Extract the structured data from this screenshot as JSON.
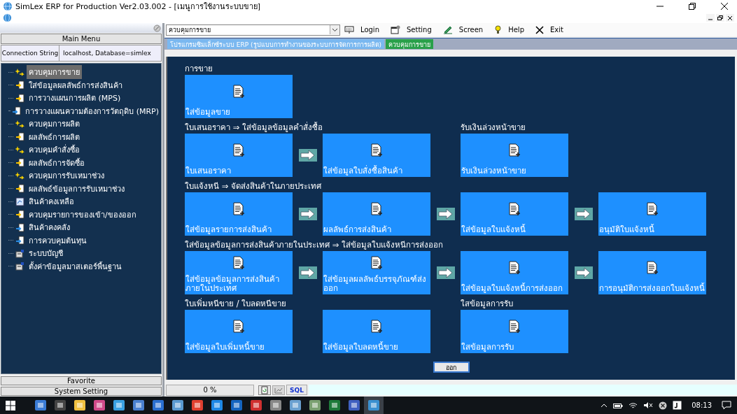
{
  "window": {
    "title": "SimLex ERP for Production Ver2.03.002 - [เมนูการใช้งานระบบขาย]"
  },
  "sidebar": {
    "header": "Main Menu",
    "connection": {
      "label": "Connection String",
      "value": "localhost,  Database=simlex"
    },
    "items": [
      {
        "label": "ควบคุมการขาย",
        "kind": "spark",
        "selected": true
      },
      {
        "label": "ใส่ข้อมูลผลลัพธ์การส่งสินค้า",
        "kind": "enter",
        "selected": false
      },
      {
        "label": "การวางแผนการผลิต (MPS)",
        "kind": "enter",
        "selected": false
      },
      {
        "label": "การวางแผนความต้องการวัตถุดิบ (MRP)",
        "kind": "blue",
        "selected": false
      },
      {
        "label": "ควบคุมการผลิต",
        "kind": "spark",
        "selected": false
      },
      {
        "label": "ผลลัพธ์การผลิต",
        "kind": "enter",
        "selected": false
      },
      {
        "label": "ควบคุมคำสั่งซื้อ",
        "kind": "spark",
        "selected": false
      },
      {
        "label": "ผลลัพธ์การจัดซื้อ",
        "kind": "enter",
        "selected": false
      },
      {
        "label": "ควบคุมการรับเหมาช่วง",
        "kind": "spark",
        "selected": false
      },
      {
        "label": "ผลลัพธ์ข้อมูลการรับเหมาช่วง",
        "kind": "enter",
        "selected": false
      },
      {
        "label": "สินค้าคงเหลือ",
        "kind": "report",
        "selected": false
      },
      {
        "label": "ควบคุมรายการของเข้า/ของออก",
        "kind": "enter",
        "selected": false
      },
      {
        "label": "สินค้าคงคลัง",
        "kind": "blue",
        "selected": false
      },
      {
        "label": "การควบคุมต้นทุน",
        "kind": "blue",
        "selected": false
      },
      {
        "label": "ระบบบัญชี",
        "kind": "cabinet",
        "selected": false
      },
      {
        "label": "ตั้งค่าข้อมูลมาสเตอร์พื้นฐาน",
        "kind": "cabinet",
        "selected": false
      }
    ],
    "footer_buttons": [
      "Favorite",
      "System Setting"
    ]
  },
  "toolbar": {
    "combo_value": "ควบคุมการขาย",
    "buttons": [
      {
        "label": "Login",
        "kind": "login"
      },
      {
        "label": "Setting",
        "kind": "setting"
      },
      {
        "label": "Screen",
        "kind": "screen"
      },
      {
        "label": "Help",
        "kind": "help"
      },
      {
        "label": "Exit",
        "kind": "exit"
      }
    ]
  },
  "breadcrumb": [
    {
      "label": "โปรแกรมซิมเล็กซ์ระบบ ERP (รูปแบบการทำงานของระบบการจัดการการผลิต)",
      "selected": false
    },
    {
      "label": "ควบคุมการขาย",
      "selected": true
    }
  ],
  "sections": [
    {
      "cells": [
        {
          "kind": "tile",
          "heading": "การขาย",
          "label": "ใส่ข้อมูลขาย"
        }
      ]
    },
    {
      "cells": [
        {
          "kind": "tile",
          "heading": "ใบเสนอราคา ⇒ ใส่ข้อมูลข้อมูลคำสั่งซื้อ",
          "label": "ใบเสนอราคา"
        },
        {
          "kind": "arrow"
        },
        {
          "kind": "tile",
          "label": "ใส่ข้อมูลใบสั่งซื้อสินค้า"
        },
        {
          "kind": "space"
        },
        {
          "kind": "tile",
          "heading": "รับเงินล่วงหน้าขาย",
          "label": "รับเงินล่วงหน้าขาย"
        }
      ]
    },
    {
      "cells": [
        {
          "kind": "tile",
          "heading": "ใบแจ้งหนี ⇒ จัดส่งสินค้าในภายประเทศ",
          "label": "ใส่ข้อมูลรายการส่งสินค้า"
        },
        {
          "kind": "arrow"
        },
        {
          "kind": "tile",
          "label": "ผลลัพธ์การส่งสินค้า"
        },
        {
          "kind": "arrow"
        },
        {
          "kind": "tile",
          "label": "ใส่ข้อมูลใบแจ้งหนี้"
        },
        {
          "kind": "arrow"
        },
        {
          "kind": "tile",
          "label": "อนุมัติใบแจ้งหนี้"
        }
      ]
    },
    {
      "cells": [
        {
          "kind": "tile",
          "heading": "ใส่ข้อมูลข้อมูลการส่งสินค้าภายในประเทศ ⇒ ใส่ข้อมูลใบแจ้งหนีการส่งออก",
          "label": "ใส่ข้อมูลข้อมูลการส่งสินค้าภายในประเทศ"
        },
        {
          "kind": "arrow"
        },
        {
          "kind": "tile",
          "label": "ใส่ข้อมูลผลลัพธ์บรรจุภัณฑ์ส่งออก"
        },
        {
          "kind": "arrow"
        },
        {
          "kind": "tile",
          "label": "ใส่ข้อมูลใบแจ้งหนี้การส่งออก"
        },
        {
          "kind": "arrow"
        },
        {
          "kind": "tile",
          "label": "การอนุมัติการส่งออกใบแจ้งหนี้"
        }
      ]
    },
    {
      "cells": [
        {
          "kind": "tile",
          "heading": "ใบเพิ่มหนีขาย / ใบลดหนีขาย",
          "label": "ใส่ข้อมูลใบเพิ่มหนี้ขาย"
        },
        {
          "kind": "space"
        },
        {
          "kind": "tile",
          "label": "ใส่ข้อมูลใบลดหนี้ขาย"
        },
        {
          "kind": "space"
        },
        {
          "kind": "tile",
          "heading": "ใสข้อมูลการรับ",
          "label": "ใสข้อมูลการรับ"
        }
      ]
    }
  ],
  "exit_button": "ออก",
  "status_bar": {
    "progress": "0 %",
    "sql": "SQL"
  },
  "taskbar": {
    "time": "08:13"
  }
}
